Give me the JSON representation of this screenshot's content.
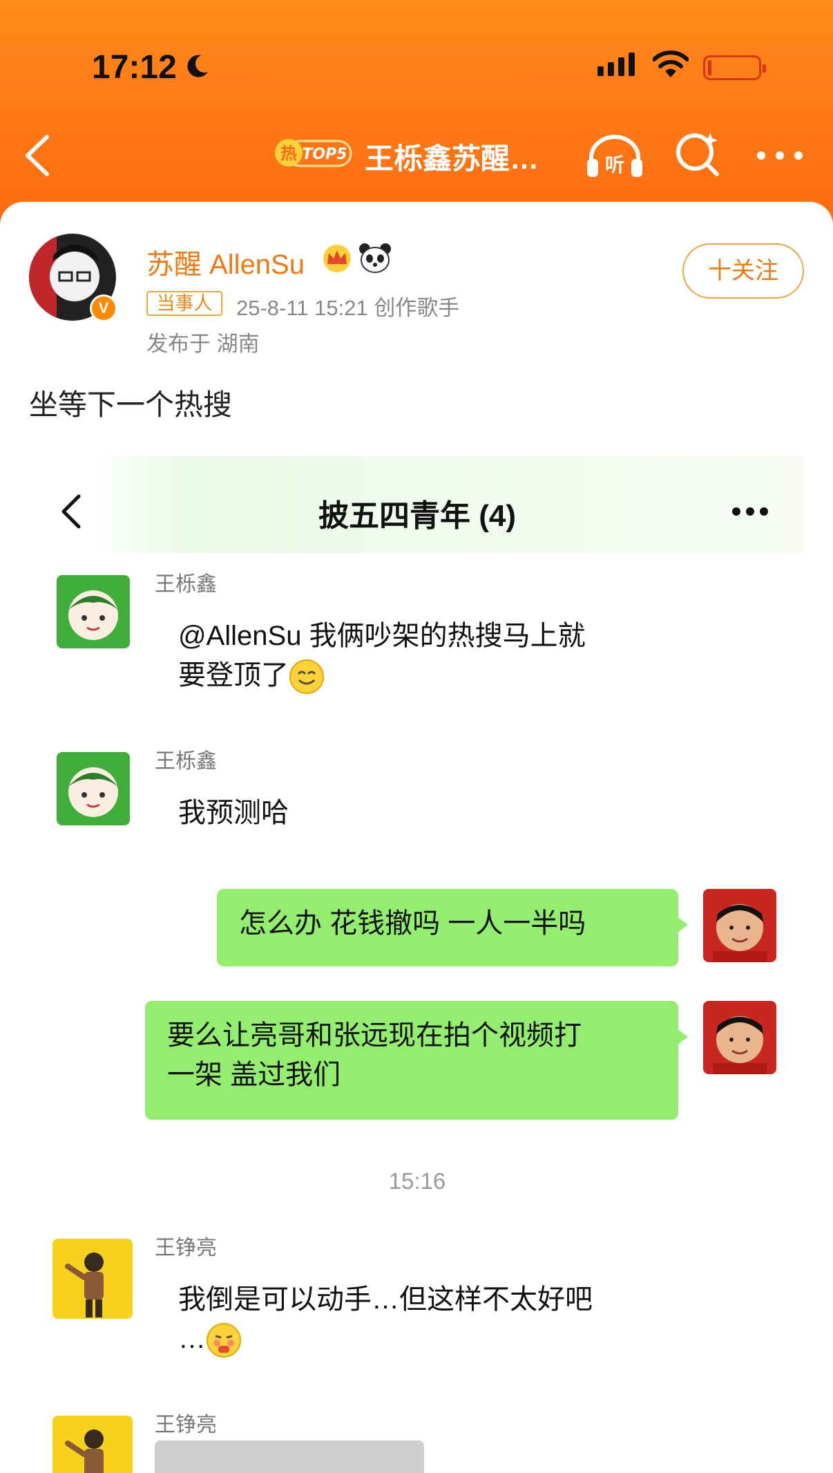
{
  "status_bar": {
    "time": "17:12"
  },
  "nav": {
    "hot_badge": "热 TOP5",
    "title": "王栎鑫苏醒…"
  },
  "post": {
    "user_name": "苏醒 AllenSu",
    "role_badge": "当事人",
    "meta": "25-8-11 15:21  创作歌手",
    "location": "发布于 湖南",
    "follow_label": "十关注",
    "text": "坐等下一个热搜"
  },
  "chat": {
    "title": "披五四青年 (4)",
    "messages": [
      {
        "sender": "王栎鑫",
        "text_line1": "@AllenSu 我俩吵架的热搜马上就",
        "text_line2": "要登顶了"
      },
      {
        "sender": "王栎鑫",
        "text": "我预测哈"
      },
      {
        "text": "怎么办 花钱撤吗 一人一半吗"
      },
      {
        "text_line1": "要么让亮哥和张远现在拍个视频打",
        "text_line2": "一架 盖过我们"
      },
      {
        "sender": "王铮亮",
        "text_line1": "我倒是可以动手…但这样不太好吧",
        "text_line2": "…"
      },
      {
        "sender": "王铮亮"
      }
    ],
    "time_separator": "15:16"
  },
  "colors": {
    "header": "#ff7a14",
    "accent": "#f07a12",
    "bubble_green": "#93ee6f"
  },
  "icons": [
    "moon-icon",
    "signal-icon",
    "wifi-icon",
    "battery-icon",
    "back-icon",
    "headphones-icon",
    "search-icon",
    "more-icon",
    "crown-icon",
    "panda-icon",
    "smile-emoji",
    "embarrassed-emoji"
  ]
}
